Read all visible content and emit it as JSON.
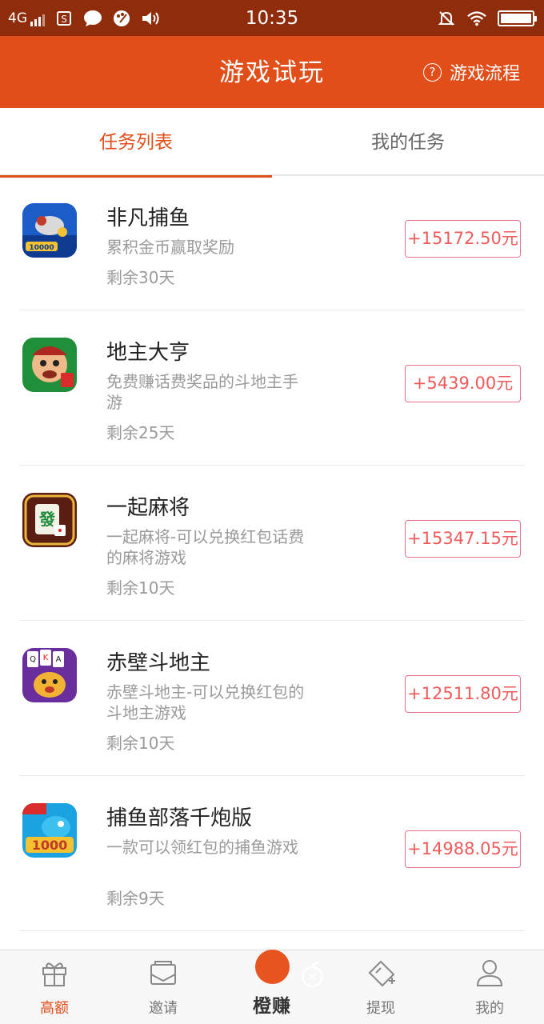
{
  "status_bar": {
    "network": "4G",
    "time": "10:35",
    "battery_level": 1.0
  },
  "header": {
    "title": "游戏试玩",
    "help_label": "游戏流程",
    "help_icon": "question-circle-icon",
    "color": "#e24e19"
  },
  "tabs": [
    {
      "label": "任务列表",
      "active": true
    },
    {
      "label": "我的任务",
      "active": false
    }
  ],
  "games": [
    {
      "name": "非凡捕鱼",
      "desc": "累积金币赢取奖励",
      "days": "剩余30天",
      "reward": "+15172.50元",
      "icon": "fish-game-icon"
    },
    {
      "name": "地主大亨",
      "desc": "免费赚话费奖品的斗地主手游",
      "days": "剩余25天",
      "reward": "+5439.00元",
      "icon": "landlord-game-icon"
    },
    {
      "name": "一起麻将",
      "desc": "一起麻将-可以兑换红包话费的麻将游戏",
      "days": "剩余10天",
      "reward": "+15347.15元",
      "icon": "mahjong-game-icon"
    },
    {
      "name": "赤壁斗地主",
      "desc": "赤壁斗地主-可以兑换红包的斗地主游戏",
      "days": "剩余10天",
      "reward": "+12511.80元",
      "icon": "card-game-icon"
    },
    {
      "name": "捕鱼部落千炮版",
      "desc": "一款可以领红包的捕鱼游戏",
      "days": "剩余9天",
      "reward": "+14988.05元",
      "icon": "fishing-tribe-icon"
    }
  ],
  "bottom_nav": [
    {
      "label": "高额",
      "icon": "gift-icon",
      "active": true
    },
    {
      "label": "邀请",
      "icon": "envelope-icon",
      "active": false
    },
    {
      "label": "橙赚",
      "icon": "orange-logo-icon",
      "active": false
    },
    {
      "label": "提现",
      "icon": "ticket-icon",
      "active": false
    },
    {
      "label": "我的",
      "icon": "user-icon",
      "active": false
    }
  ]
}
